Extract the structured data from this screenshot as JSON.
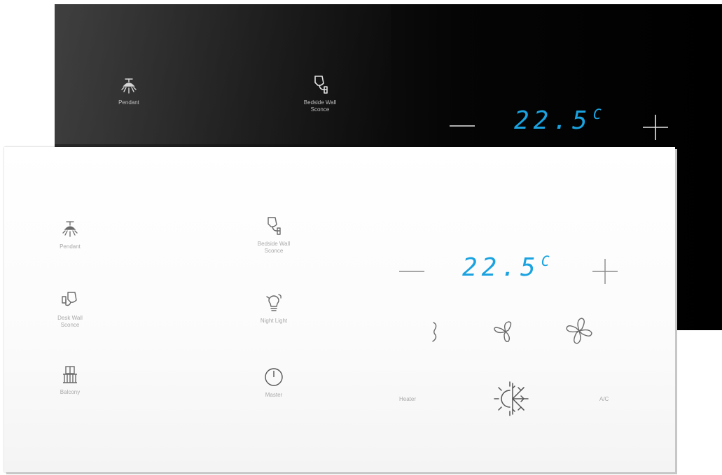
{
  "black_panel": {
    "lights": [
      {
        "label": "Pendant",
        "icon": "pendant-icon"
      },
      {
        "label": "Bedside Wall\nSconce",
        "icon": "wall-sconce-icon"
      }
    ],
    "thermostat": {
      "temperature": "22.5",
      "unit": "C",
      "minus": "decrease-icon",
      "plus": "increase-icon"
    }
  },
  "white_panel": {
    "lights": [
      {
        "label": "Pendant",
        "icon": "pendant-icon"
      },
      {
        "label": "Bedside Wall\nSconce",
        "icon": "wall-sconce-icon"
      },
      {
        "label": "Desk Wall\nSconce",
        "icon": "desk-sconce-icon"
      },
      {
        "label": "Night Light",
        "icon": "night-light-icon"
      },
      {
        "label": "Balcony",
        "icon": "balcony-icon"
      },
      {
        "label": "Master",
        "icon": "power-icon"
      }
    ],
    "thermostat": {
      "temperature": "22.5",
      "unit": "C",
      "fan_speeds": [
        "fan-low-icon",
        "fan-medium-icon",
        "fan-high-icon"
      ],
      "mode_left": "Heater",
      "mode_right": "A/C",
      "mode_icon": "heat-cool-icon"
    }
  },
  "colors": {
    "accent": "#1aa3e0",
    "label_gray": "#a9a9a9",
    "icon_gray": "#6a6a6a"
  }
}
